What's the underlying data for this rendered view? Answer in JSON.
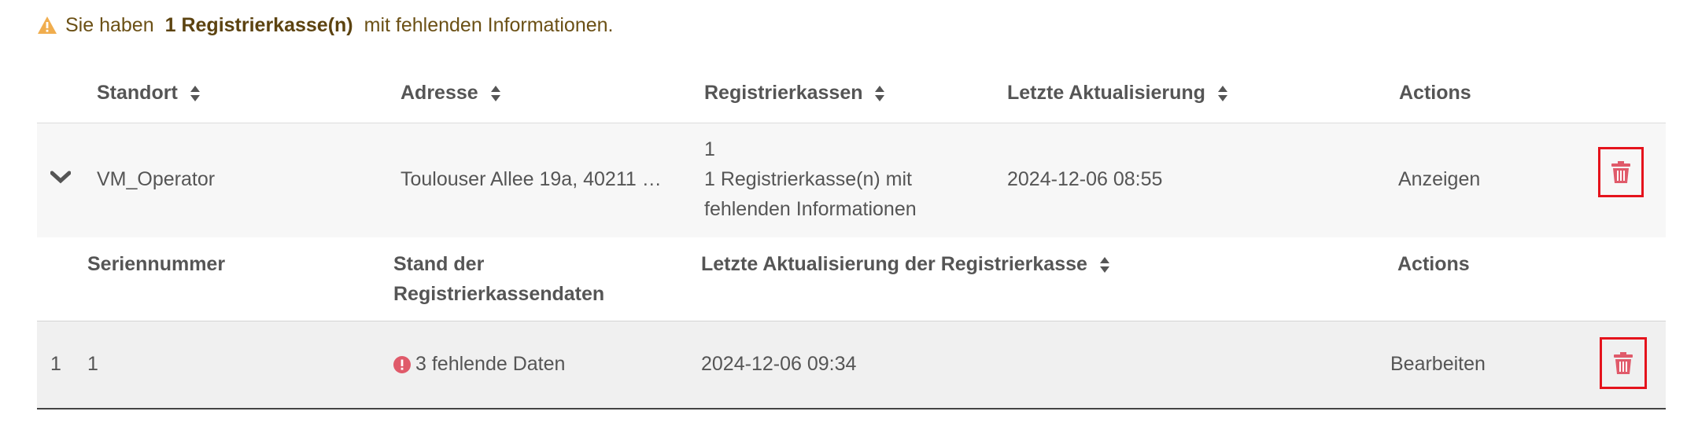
{
  "alert": {
    "prefix": "Sie haben",
    "highlight": "1 Registrierkasse(n)",
    "suffix": "mit fehlenden Informationen."
  },
  "table": {
    "headers": [
      "Standort",
      "Adresse",
      "Registrierkassen",
      "Letzte Aktualisierung",
      "Actions"
    ],
    "rows": [
      {
        "standort": "VM_Operator",
        "adresse": "Toulouser Allee 19a, 40211 …",
        "count": "1",
        "missing_line1": "1 Registrierkasse(n) mit",
        "missing_line2": "fehlenden Informationen",
        "updated": "2024-12-06 08:55",
        "action": "Anzeigen"
      }
    ]
  },
  "subtable": {
    "headers": {
      "serial": "Seriennummer",
      "stand_line1": "Stand der",
      "stand_line2": "Registrierkassendaten",
      "updated": "Letzte Aktualisierung der Registrierkasse",
      "actions": "Actions"
    },
    "rows": [
      {
        "index": "1",
        "serial": "1",
        "status": "3 fehlende Daten",
        "updated": "2024-12-06 09:34",
        "action": "Bearbeiten"
      }
    ]
  },
  "colors": {
    "warning": "#f0ad4e",
    "danger": "#e05a6a",
    "link": "#1a9bc2",
    "highlight_border": "#e5131c"
  }
}
